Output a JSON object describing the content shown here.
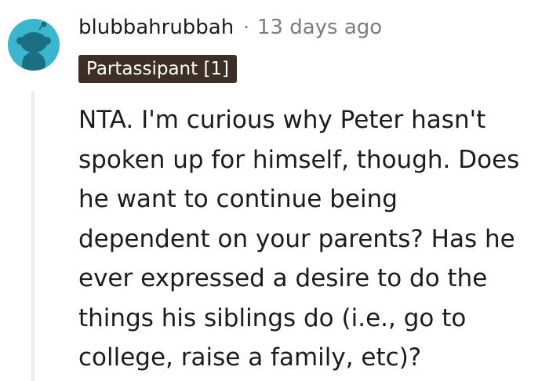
{
  "comment": {
    "username": "blubbahrubbah",
    "separator": "·",
    "timestamp": "13 days ago",
    "flair": "Partassipant [1]",
    "avatar_icon": "reddit-snoo-avatar-icon",
    "body": "NTA. I'm curious why Peter hasn't\nspoken up for himself, though. Does\nhe want to continue being\ndependent on your parents? Has he\never expressed a desire to do the\nthings his siblings do (i.e., go to\ncollege, raise a family, etc)?"
  },
  "colors": {
    "avatar_bg": "#3bb6cf",
    "flair_bg": "#3e2f26",
    "text": "#1c1c1c",
    "meta": "#7c7c7c",
    "thread_line": "#ececec"
  }
}
